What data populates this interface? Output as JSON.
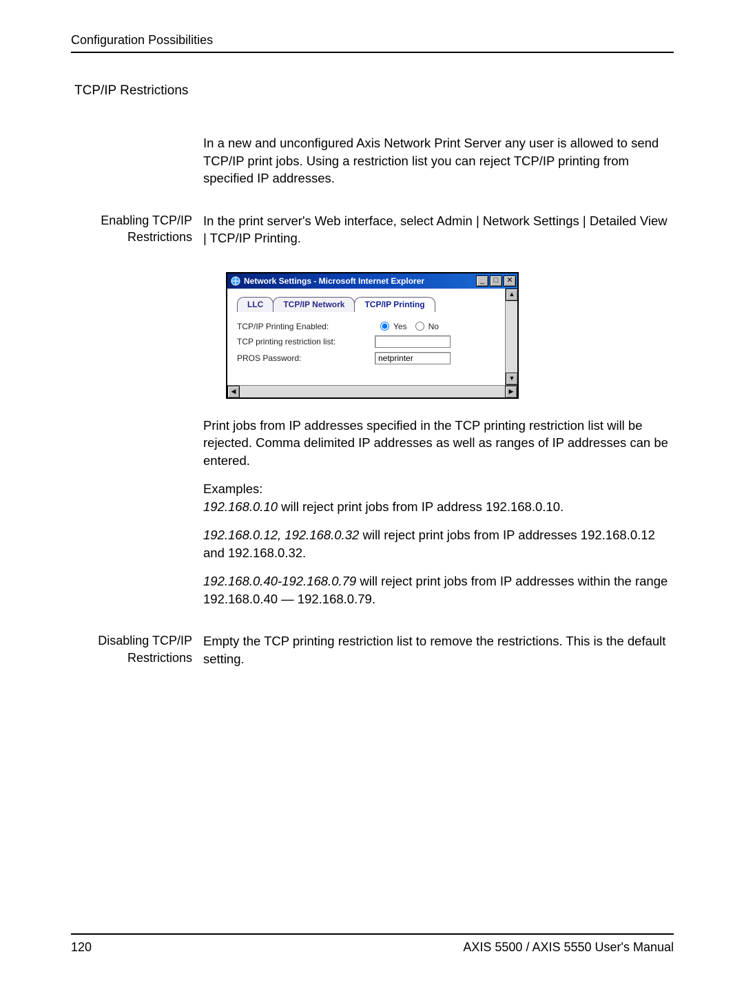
{
  "header": {
    "running_head": "Configuration Possibilities"
  },
  "section": {
    "title": "TCP/IP Restrictions"
  },
  "intro": {
    "paragraph": "In a new and unconfigured Axis Network Print Server any user is allowed to send TCP/IP print jobs. Using a restriction list you can reject TCP/IP printing from specified IP addresses."
  },
  "enabling": {
    "gutter_line1": "Enabling TCP/IP",
    "gutter_line2": "Restrictions",
    "paragraph": "In the print server's Web interface, select Admin | Network Settings | Detailed View | TCP/IP Printing."
  },
  "ie_window": {
    "title": "Network Settings - Microsoft Internet Explorer",
    "tabs": {
      "llc": "LLC",
      "tcpip_network": "TCP/IP Network",
      "tcpip_printing": "TCP/IP Printing"
    },
    "form": {
      "printing_enabled_label": "TCP/IP Printing Enabled:",
      "yes": "Yes",
      "no": "No",
      "printing_enabled_value": "yes",
      "restriction_list_label": "TCP printing restriction list:",
      "restriction_list_value": "",
      "pros_password_label": "PROS Password:",
      "pros_password_value": "netprinter"
    }
  },
  "post_screenshot": {
    "p1": "Print jobs from IP addresses specified in the TCP printing restriction list will be rejected. Comma delimited IP addresses as well as ranges of IP addresses can be entered.",
    "examples_label": "Examples:",
    "ex1_ip": "192.168.0.10",
    "ex1_rest": " will reject print jobs from IP address 192.168.0.10.",
    "ex2_ip": "192.168.0.12, 192.168.0.32",
    "ex2_rest": " will reject print jobs from IP addresses 192.168.0.12 and 192.168.0.32.",
    "ex3_ip": "192.168.0.40-192.168.0.79",
    "ex3_rest": " will reject print jobs from IP addresses within the range 192.168.0.40 — 192.168.0.79."
  },
  "disabling": {
    "gutter_line1": "Disabling TCP/IP",
    "gutter_line2": "Restrictions",
    "paragraph": "Empty the TCP printing restriction list to remove the restrictions. This is the default setting."
  },
  "footer": {
    "page_number": "120",
    "manual_title": "AXIS 5500 / AXIS 5550 User's Manual"
  }
}
